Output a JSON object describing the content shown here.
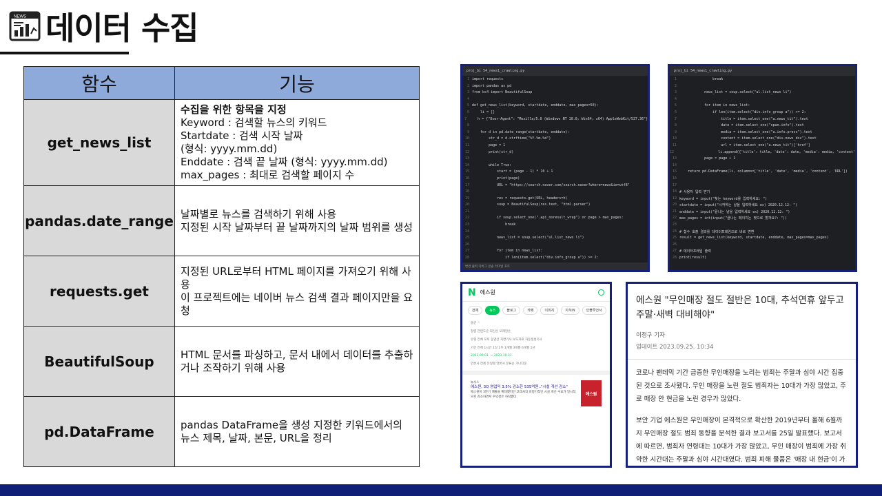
{
  "title": "데이터 수집",
  "title_icon": "news-chart-icon",
  "table": {
    "headers": [
      "함수",
      "기능"
    ],
    "rows": [
      {
        "name": "get_news_list",
        "lines": [
          "수집을 위한 항목을 지정",
          "Keyword : 검색할 뉴스의 키워드",
          "Startdate : 검색 시작 날짜",
          "(형식: yyyy.mm.dd)",
          "Enddate : 검색 끝 날짜 (형식: yyyy.mm.dd)",
          "max_pages : 최대로 검색할 페이지 수"
        ]
      },
      {
        "name": "pandas.date_range",
        "lines": [
          "날짜별로 뉴스를 검색하기 위해 사용",
          "지정된 시작 날짜부터 끝 날짜까지의 날짜 범위를 생성"
        ]
      },
      {
        "name": "requests.get",
        "lines": [
          "지정된 URL로부터 HTML 페이지를 가져오기 위해 사용",
          "이 프로젝트에는 네이버 뉴스 검색 결과 페이지만을 요청"
        ]
      },
      {
        "name": "BeautifulSoup",
        "lines": [
          "HTML 문서를 파싱하고, 문서 내에서 데이터를 추출하거나 조작하기 위해 사용"
        ]
      },
      {
        "name": "pd.DataFrame",
        "lines": [
          "pandas DataFrame을 생성 지정한 키워드에서의 뉴스 제목, 날짜, 본문, URL을 정리"
        ]
      }
    ]
  },
  "code_left": {
    "tab": "proj_bi 54_news1_crawling.py",
    "lines": [
      "import requests",
      "import pandas as pd",
      "from bs4 import BeautifulSoup",
      "",
      "def get_news_list(keyword, startdate, enddate, max_pages=50):",
      "    li = []",
      "    h = {\"User-Agent\": \"Mozilla/5.0 (Windows NT 10.0; Win64; x64) AppleWebKit/537.36\"}",
      "",
      "    for d in pd.date_range(startdate, enddate):",
      "        str_d = d.strftime(\"%Y.%m.%d\")",
      "        page = 1",
      "        print(str_d)",
      "",
      "        while True:",
      "            start = (page - 1) * 10 + 1",
      "            print(page)",
      "            URL = \"https://search.naver.com/search.naver?where=news&ie=utf8\"",
      "",
      "            res = requests.get(URL, headers=h)",
      "            soup = BeautifulSoup(res.text, \"html.parser\")",
      "",
      "            if soup.select_one(\".api_noresult_wrap\") or page > max_pages:",
      "                break",
      "",
      "            news_list = soup.select(\"ul.list_news li\")",
      "",
      "            for item in news_list:",
      "                if len(item.select(\"div.info_group a\")) >= 2:",
      "                    title = item.select_one(\"a.news_tit\").text",
      "                    date = item.select_one(\"span.info\").text",
      "                    media = item.select_one(\"a.info.press\").text",
      "                    content = item.select_one(\"div.news_dsc\").text"
    ],
    "footer": "변경  출력  디버그 콘솔  터미널  포트"
  },
  "code_right": {
    "tab": "proj_bi 54_news1_crawling.py",
    "lines": [
      "                break",
      "",
      "            news_list = soup.select(\"ul.list_news li\")",
      "",
      "            for item in news_list:",
      "                if len(item.select(\"div.info_group a\")) >= 2:",
      "                    title = item.select_one(\"a.news_tit\").text",
      "                    date = item.select_one(\"span.info\").text",
      "                    media = item.select_one(\"a.info.press\").text",
      "                    content = item.select_one(\"div.news_dsc\").text",
      "                    url = item.select_one(\"a.news_tit\")['href']",
      "                    li.append({'title': title, 'date': date, 'media': media, 'content': content, 'URL': url})",
      "            page = page + 1",
      "",
      "    return pd.DataFrame(li, columns=['title', 'date', 'media', 'content', 'URL'])",
      "",
      "",
      "# 사용자 입력 받기",
      "keyword = input(\"찾는 keyword를 입력하세요: \")",
      "startdate = input(\"시작하는 날을 입력하세요 ex) 2020.12.12: \")",
      "enddate = input(\"끝나는 날을 입력하세요 ex) 2020.12.12: \")",
      "max_pages = int(input(\"끝나는 페이지는 몇으로 할까요?: \"))",
      "",
      "# 함수 호출 결과를 데이터프레임으로 바로 변환",
      "result = get_news_list(keyword, startdate, enddate, max_pages=max_pages)",
      "",
      "# 데이터프레임 출력",
      "print(result)"
    ]
  },
  "naver": {
    "logo": "N",
    "query": "에스원",
    "tabs": [
      "전체",
      "뉴스",
      "블로그",
      "카페",
      "이미지",
      "지식iN",
      "인플루언서"
    ],
    "rows": [
      "옵션 ^",
      "정렬  관련도순  최신순  오래된순",
      "유형  전체  포토  동영상  지면기사  보도자료  자동생성기사",
      "기간  전체  1시간  1일  1주  1개월  3개월  6개월  1년",
      "2023.09.01. ~ 2023.10.31.",
      "언론사  전체  유형별  언론사 분류순  가나다순"
    ],
    "news_source": "뉴시스",
    "news_title": "에스원, 3Q 영업익 3.5% 감소한 535억원..\"시설 개선 감소\"",
    "news_snippet": "에스원이 3분기 매출을 확대했지만 고객사의 비정기적인 시설 개선 수요가 일시적으로 감소하면서 수익성은 하락했다.",
    "news_thumb": "에스원"
  },
  "article": {
    "title": "에스원 \"무인매장 절도 절반은 10대, 추석연휴 앞두고 주말·새벽 대비해야\"",
    "author": "이정구 기자",
    "updated": "업데이트 2023.09.25. 10:34",
    "paragraphs": [
      "코로나 팬데믹 기간 급증한 무인매장을 노리는 범죄는 주말과 심야 시간 집중된 것으로 조사됐다. 무인 매장을 노린 절도 범죄자는 10대가 가장 많았고, 주로 매장 안 현금을 노린 경우가 많았다.",
      "보안 기업 에스원은 무인매장이 본격적으로 확산한 2019년부터 올해 6월까지 무인매장 절도 범죄 동향을 분석한 결과 보고서를 25일 발표했다. 보고서에 따르면, 범죄자 연령대는 10대가 가장 많았고, 무인 매장이 범죄에 가장 취약한 시간대는 주말과 심야 시간대였다. 범죄 피해 물품은 '매장 내 현금'이 가장 높은 것으로 나타났다."
    ]
  },
  "colors": {
    "header_bg": "#8eaadb",
    "name_cell_bg": "#d9d9d9",
    "frame_border": "#15207a",
    "bottom_bar": "#0f1f78",
    "naver_green": "#03c75a"
  }
}
